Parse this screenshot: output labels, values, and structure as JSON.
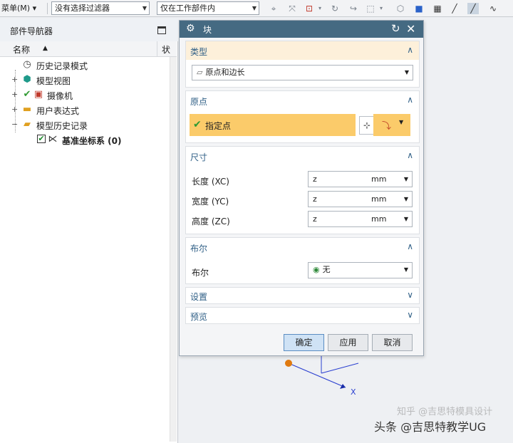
{
  "toolbar": {
    "menu_label": "菜单(M)",
    "menu_arrow": "▾",
    "filter_select": "没有选择过滤器",
    "scope_select": "仅在工作部件内"
  },
  "navigator": {
    "title": "部件导航器",
    "col_name": "名称",
    "col_status": "状",
    "items": [
      {
        "label": "历史记录模式",
        "icon": "clock-icon"
      },
      {
        "label": "模型视图",
        "icon": "model-views-icon"
      },
      {
        "label": "摄像机",
        "icon": "camera-icon"
      },
      {
        "label": "用户表达式",
        "icon": "folder-icon"
      },
      {
        "label": "模型历史记录",
        "icon": "folder-open-icon"
      },
      {
        "label": "基准坐标系 (0)",
        "icon": "datum-csys-icon"
      }
    ]
  },
  "dialog": {
    "title": "块",
    "type_section": {
      "title": "类型",
      "selected": "原点和边长"
    },
    "origin_section": {
      "title": "原点",
      "specify_point": "指定点"
    },
    "dimension_section": {
      "title": "尺寸",
      "rows": [
        {
          "label": "长度 (XC)",
          "value": "z",
          "unit": "mm"
        },
        {
          "label": "宽度 (YC)",
          "value": "z",
          "unit": "mm"
        },
        {
          "label": "高度 (ZC)",
          "value": "z",
          "unit": "mm"
        }
      ]
    },
    "boolean_section": {
      "title": "布尔",
      "label": "布尔",
      "value": "无"
    },
    "settings_title": "设置",
    "preview_title": "预览",
    "buttons": {
      "ok": "确定",
      "apply": "应用",
      "cancel": "取消"
    }
  },
  "viewport": {
    "axis_label": "X"
  },
  "watermark": {
    "text": "头条 @吉思特教学UG",
    "faint": "知乎 @吉思特模具设计"
  },
  "colors": {
    "title_bar": "#456a82",
    "section_title": "#2f5f86",
    "highlight": "#fbcb6a",
    "axis": "#2a3fd0",
    "origin_point": "#e07a10"
  }
}
